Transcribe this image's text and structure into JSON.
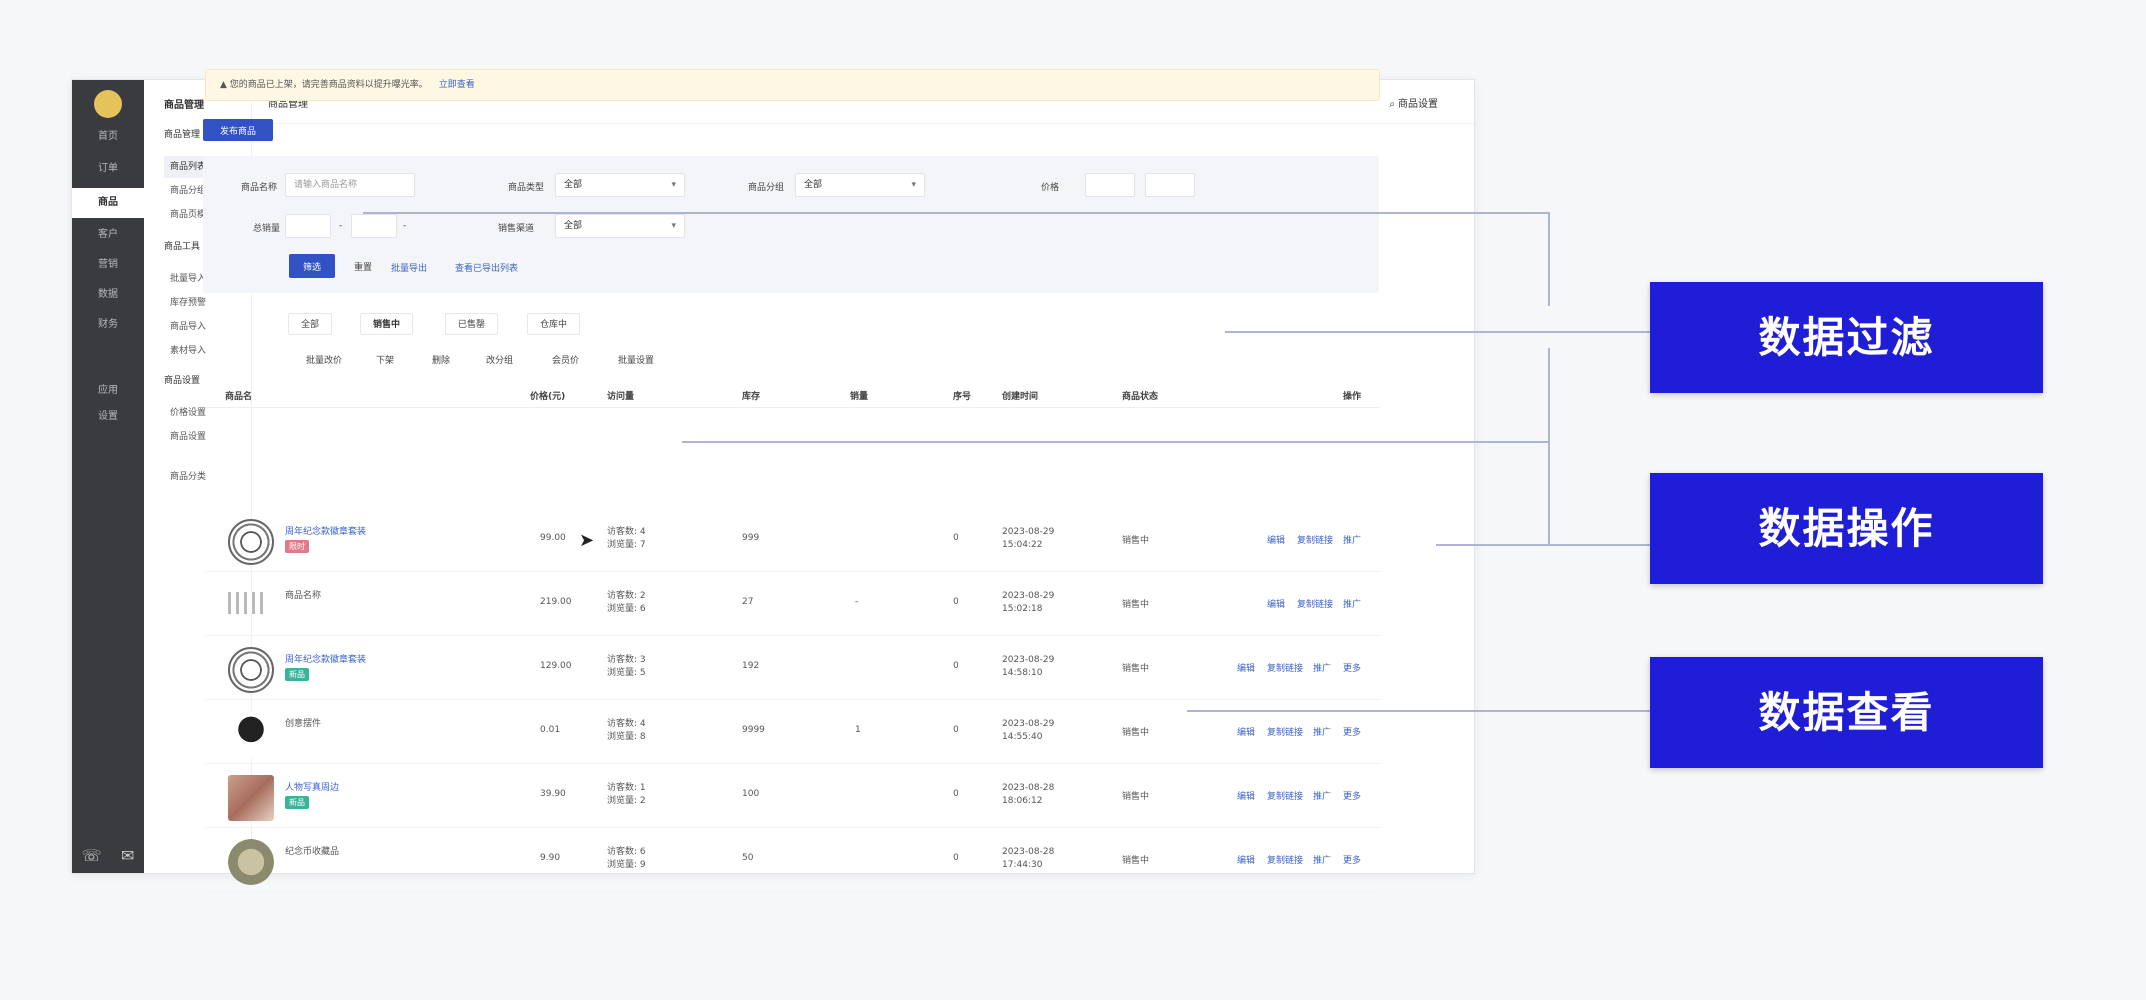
{
  "rail": {
    "items": [
      "首页",
      "订单",
      "商品",
      "客户",
      "营销",
      "数据",
      "财务",
      "应用",
      "设置"
    ]
  },
  "subnav": {
    "title": "商品管理",
    "items": [
      {
        "label": "商品管理",
        "group": true
      },
      {
        "label": "商品列表",
        "active": true
      },
      {
        "label": "商品分组"
      },
      {
        "label": "商品页模板"
      },
      {
        "label": "商品工具",
        "group": true
      },
      {
        "label": "批量导入"
      },
      {
        "label": "库存预警"
      },
      {
        "label": "商品导入"
      },
      {
        "label": "素材导入"
      },
      {
        "label": "商品设置",
        "group": true
      },
      {
        "label": "价格设置"
      },
      {
        "label": "商品设置"
      },
      {
        "label": "商品分类"
      }
    ]
  },
  "header": {
    "page_title": "商品管理",
    "help": "商品设置"
  },
  "notice": {
    "text": "您的商品已上架，请完善商品资料以提升曝光率。",
    "link": "立即查看"
  },
  "toolbar": {
    "publish_label": "发布商品"
  },
  "filter": {
    "name_label": "商品名称",
    "name_placeholder": "请输入商品名称",
    "type_label": "商品类型",
    "type_value": "全部",
    "group_label": "商品分组",
    "group_value": "全部",
    "price_label": "价格",
    "sales_label": "总销量",
    "sales_sep1": "-",
    "sales_sep2": "-",
    "channel_label": "销售渠道",
    "channel_value": "全部",
    "search_label": "筛选",
    "reset_label": "重置",
    "export_link": "批量导出",
    "view_link": "查看已导出列表"
  },
  "tabs": [
    "全部",
    "销售中",
    "已售罄",
    "仓库中"
  ],
  "batch_actions": [
    "批量改价",
    "下架",
    "删除",
    "改分组",
    "会员价",
    "批量设置"
  ],
  "table": {
    "headers": [
      "商品名",
      "价格(元)",
      "访问量",
      "库存",
      "销量",
      "序号",
      "创建时间",
      "商品状态",
      "操作"
    ],
    "rows": [
      {
        "thumb": "seal",
        "name": "周年纪念款徽章套装",
        "tag": "限时",
        "tag_color": "#e07a8a",
        "price": "99.00",
        "visits": [
          "访客数: 4",
          "浏览量: 7"
        ],
        "stock": "999",
        "sales": "",
        "seq": "0",
        "created": [
          "2023-08-29",
          "15:04:22"
        ],
        "status": "销售中",
        "ops": [
          "编辑",
          "复制链接",
          "推广"
        ]
      },
      {
        "thumb": "flat",
        "name": "商品名称",
        "tag": "",
        "tag_color": "",
        "price": "219.00",
        "visits": [
          "访客数: 2",
          "浏览量: 6"
        ],
        "stock": "27",
        "sales": "-",
        "seq": "0",
        "created": [
          "2023-08-29",
          "15:02:18"
        ],
        "status": "销售中",
        "ops": [
          "编辑",
          "复制链接",
          "推广"
        ]
      },
      {
        "thumb": "seal",
        "name": "周年纪念款徽章套装",
        "tag": "新品",
        "tag_color": "#3ab39a",
        "price": "129.00",
        "visits": [
          "访客数: 3",
          "浏览量: 5"
        ],
        "stock": "192",
        "sales": "",
        "seq": "0",
        "created": [
          "2023-08-29",
          "14:58:10"
        ],
        "status": "销售中",
        "ops": [
          "编辑",
          "复制链接",
          "推广",
          "更多"
        ]
      },
      {
        "thumb": "bw",
        "name": "创意摆件",
        "tag": "",
        "tag_color": "",
        "price": "0.01",
        "visits": [
          "访客数: 4",
          "浏览量: 8"
        ],
        "stock": "9999",
        "sales": "1",
        "seq": "0",
        "created": [
          "2023-08-29",
          "14:55:40"
        ],
        "status": "销售中",
        "ops": [
          "编辑",
          "复制链接",
          "推广",
          "更多"
        ]
      },
      {
        "thumb": "photo",
        "name": "人物写真周边",
        "tag": "新品",
        "tag_color": "#3ab39a",
        "price": "39.90",
        "visits": [
          "访客数: 1",
          "浏览量: 2"
        ],
        "stock": "100",
        "sales": "",
        "seq": "0",
        "created": [
          "2023-08-28",
          "18:06:12"
        ],
        "status": "销售中",
        "ops": [
          "编辑",
          "复制链接",
          "推广",
          "更多"
        ]
      },
      {
        "thumb": "coin",
        "name": "纪念币收藏品",
        "tag": "",
        "tag_color": "",
        "price": "9.90",
        "visits": [
          "访客数: 6",
          "浏览量: 9"
        ],
        "stock": "50",
        "sales": "",
        "seq": "0",
        "created": [
          "2023-08-28",
          "17:44:30"
        ],
        "status": "销售中",
        "ops": [
          "编辑",
          "复制链接",
          "推广",
          "更多"
        ]
      }
    ]
  },
  "callouts": [
    "数据过滤",
    "数据操作",
    "数据查看"
  ],
  "colors": {
    "rail_bg": "#3a3b3e",
    "primary": "#3152c4",
    "link": "#3a64c9",
    "callout_bg": "#1f1ed6",
    "connector": "#aeb3d8"
  }
}
